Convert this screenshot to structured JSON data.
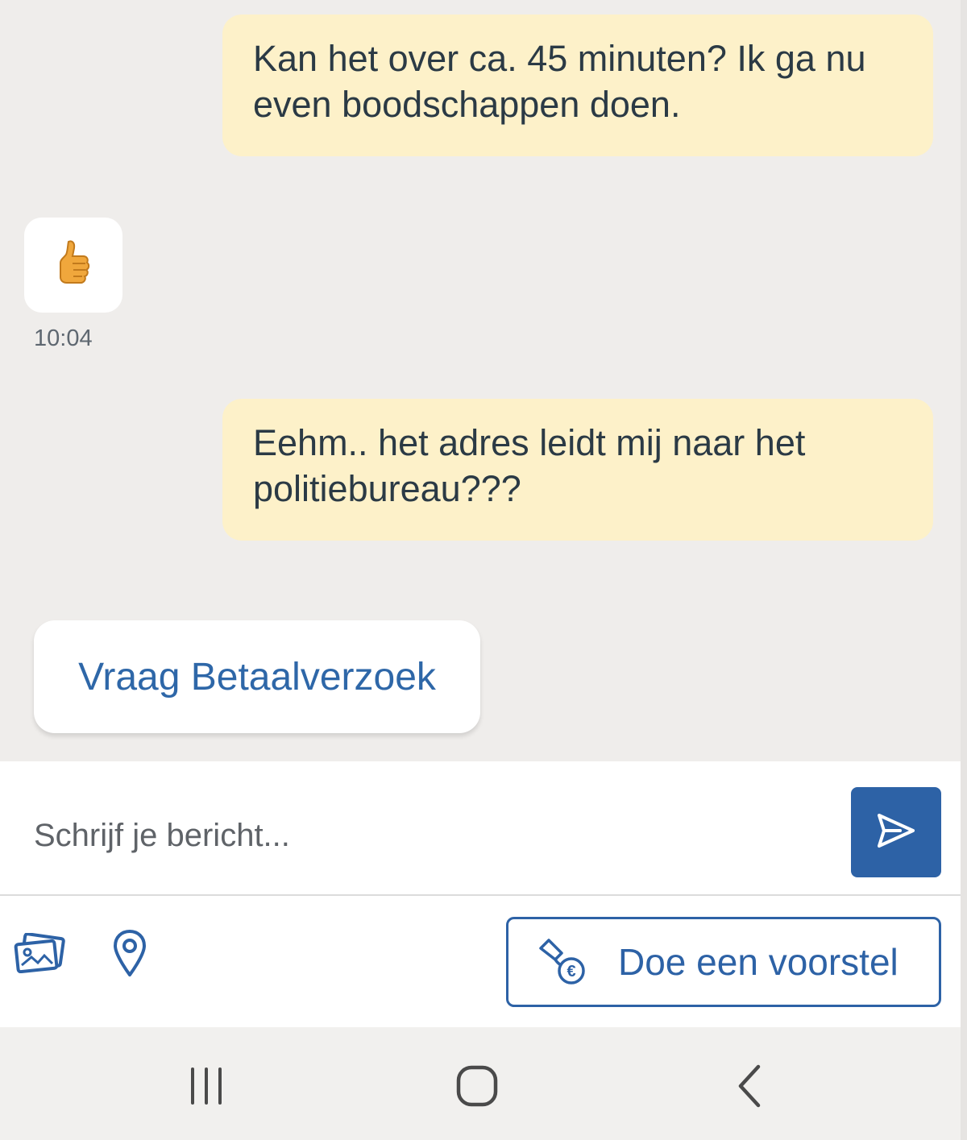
{
  "messages": [
    {
      "direction": "outgoing",
      "text": "Kan het over ca. 45 minuten? Ik ga nu even boodschappen doen."
    },
    {
      "direction": "incoming",
      "content": "thumbs-up-emoji",
      "time": "10:04"
    },
    {
      "direction": "outgoing",
      "text": "Eehm.. het adres leidt mij naar het politiebureau???"
    }
  ],
  "quick_reply": {
    "label": "Vraag Betaalverzoek"
  },
  "composer": {
    "placeholder": "Schrijf je bericht..."
  },
  "toolbar": {
    "photos_icon": "photos-icon",
    "location_icon": "location-pin-icon",
    "offer_label": "Doe een voorstel",
    "offer_icon": "hand-coin-icon"
  },
  "navbar": {
    "recent_icon": "recent-apps-icon",
    "home_icon": "home-icon",
    "back_icon": "back-icon"
  },
  "colors": {
    "chat_background": "#efedeb",
    "outgoing_bubble": "#fdf1c9",
    "accent_blue": "#2d62a6",
    "text_dark": "#2b3a45"
  }
}
